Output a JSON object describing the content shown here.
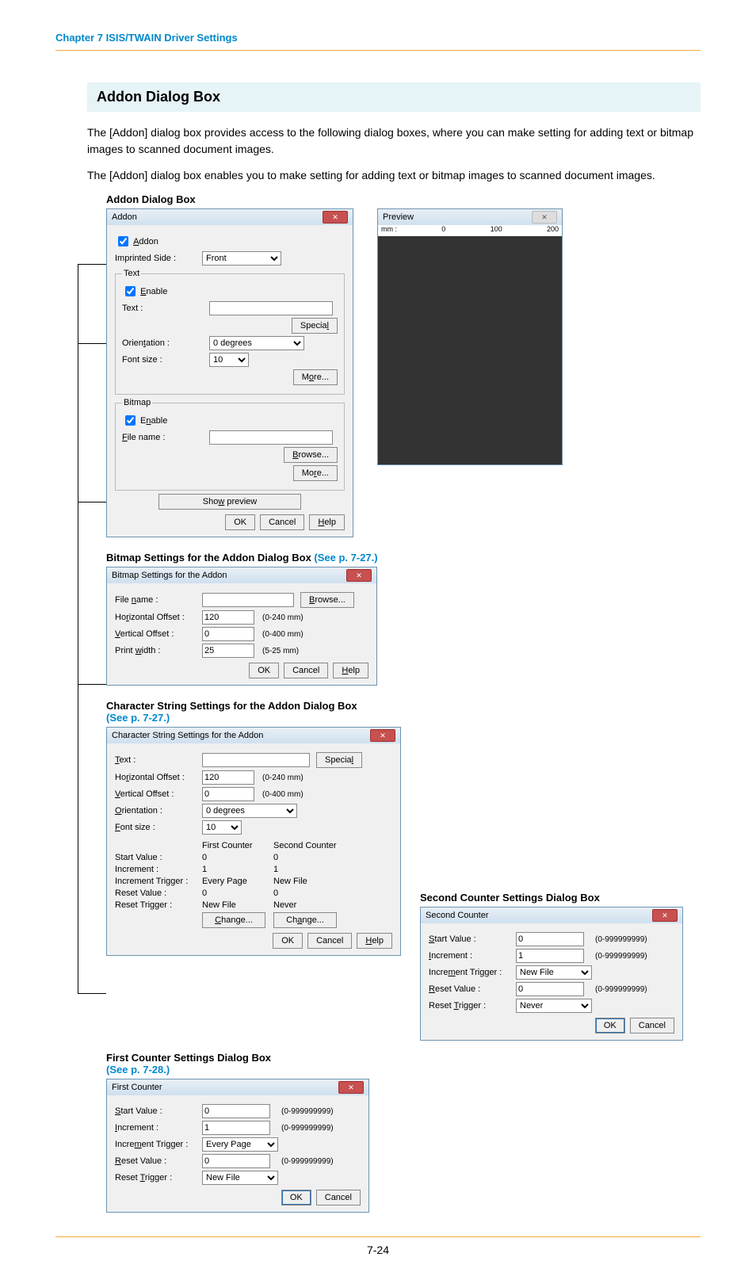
{
  "chapter": "Chapter 7   ISIS/TWAIN Driver Settings",
  "pagenum": "7-24",
  "section_title": "Addon Dialog Box",
  "para1": "The [Addon] dialog box provides access to the following dialog boxes, where you can make setting for adding text or bitmap images to scanned document images.",
  "para2": "The [Addon] dialog box enables you to make setting for adding text or bitmap images to scanned document images.",
  "h_addon": "Addon Dialog Box",
  "h_bitmap": "Bitmap Settings for the Addon Dialog Box ",
  "h_bitmap_link": "(See p. 7-27.)",
  "h_char": "Character String Settings for the Addon Dialog Box ",
  "h_char_link": "(See p. 7-27.)",
  "h_second": "Second Counter Settings Dialog Box",
  "h_first": "First Counter Settings Dialog Box",
  "h_first_link": "(See p. 7-28.)",
  "addon": {
    "title": "Addon",
    "chk": "Addon",
    "side_lbl": "Imprinted Side :",
    "side_val": "Front",
    "text_leg": "Text",
    "enable": "Enable",
    "text_lbl": "Text :",
    "special": "Special",
    "orient_lbl": "Orientation :",
    "orient_val": "0 degrees",
    "font_lbl": "Font size :",
    "font_val": "10",
    "more": "More...",
    "bmp_leg": "Bitmap",
    "file_lbl": "File name :",
    "browse": "Browse...",
    "more2": "More...",
    "show": "Show preview",
    "ok": "OK",
    "cancel": "Cancel",
    "help": "Help",
    "prev_title": "Preview",
    "mm": "mm :",
    "mm0": "0",
    "mm1": "100",
    "mm2": "200"
  },
  "bmp": {
    "title": "Bitmap Settings for the Addon",
    "file_lbl": "File name :",
    "browse": "Browse...",
    "hoff_lbl": "Horizontal Offset :",
    "hoff_val": "120",
    "hoff_rng": "(0-240 mm)",
    "voff_lbl": "Vertical Offset :",
    "voff_val": "0",
    "voff_rng": "(0-400 mm)",
    "pw_lbl": "Print width :",
    "pw_val": "25",
    "pw_rng": "(5-25 mm)",
    "ok": "OK",
    "cancel": "Cancel",
    "help": "Help"
  },
  "chr": {
    "title": "Character String Settings for the Addon",
    "text_lbl": "Text :",
    "special": "Special",
    "hoff_lbl": "Horizontal Offset :",
    "hoff_val": "120",
    "hoff_rng": "(0-240 mm)",
    "voff_lbl": "Vertical Offset :",
    "voff_val": "0",
    "voff_rng": "(0-400 mm)",
    "orient_lbl": "Orientation :",
    "orient_val": "0 degrees",
    "font_lbl": "Font size :",
    "font_val": "10",
    "c1_h": "First Counter",
    "c2_h": "Second Counter",
    "sv_lbl": "Start Value :",
    "sv1": "0",
    "sv2": "0",
    "inc_lbl": "Increment :",
    "inc1": "1",
    "inc2": "1",
    "it_lbl": "Increment Trigger :",
    "it1": "Every Page",
    "it2": "New File",
    "rv_lbl": "Reset Value :",
    "rv1": "0",
    "rv2": "0",
    "rt_lbl": "Reset Trigger :",
    "rt1": "New File",
    "rt2": "Never",
    "change": "Change...",
    "ok": "OK",
    "cancel": "Cancel",
    "help": "Help"
  },
  "first": {
    "title": "First Counter",
    "sv_lbl": "Start Value :",
    "sv": "0",
    "rng": "(0-999999999)",
    "inc_lbl": "Increment :",
    "inc": "1",
    "it_lbl": "Increment Trigger :",
    "it": "Every Page",
    "rv_lbl": "Reset Value :",
    "rv": "0",
    "rt_lbl": "Reset Trigger :",
    "rt": "New File",
    "ok": "OK",
    "cancel": "Cancel"
  },
  "second": {
    "title": "Second Counter",
    "sv_lbl": "Start Value :",
    "sv": "0",
    "rng": "(0-999999999)",
    "inc_lbl": "Increment :",
    "inc": "1",
    "it_lbl": "Increment Trigger :",
    "it": "New File",
    "rv_lbl": "Reset Value :",
    "rv": "0",
    "rt_lbl": "Reset Trigger :",
    "rt": "Never",
    "ok": "OK",
    "cancel": "Cancel"
  }
}
